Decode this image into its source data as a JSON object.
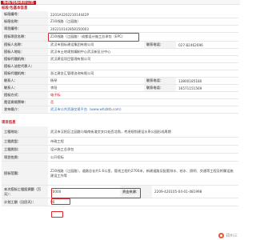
{
  "header": {
    "title": "标段/招标项目公告"
  },
  "section1": {
    "title": "标段/包基本信息"
  },
  "rows": {
    "code": {
      "label": "标段编号：",
      "value": "2201A320221014442P"
    },
    "sect_name": {
      "label": "标段名称：",
      "value": "Z10线路（江园路）"
    },
    "project_code": {
      "label": "项目编号：",
      "value": "202210142858150003"
    },
    "project_name": {
      "label": "招标项目名称：",
      "value": "Z10线路（江园路）-成都设计施工总承包（EPC）"
    },
    "tender_org": {
      "label": "招标人名称：",
      "value": "武汉市国际建设集团有限公司"
    },
    "tender_contact_label": {
      "label": "联系电话：",
      "value": "027-82462696"
    },
    "address": {
      "label": "招标人地址：",
      "value": "武汉市土地规划编制中心武汉新区分中心"
    },
    "agent": {
      "label": "招标代理机构：",
      "value": "武汉建设项目管理有限公司"
    },
    "agent_rep": {
      "label": "招标人法定代表人：",
      "value": ""
    },
    "agent_org": {
      "label": "招标代理机构：",
      "value": "浙江建金汇管理咨询有限公司"
    },
    "contact": {
      "label": "联系人：",
      "value": "杨琴",
      "phone_label": "联系电话：",
      "phone": "13800185180"
    },
    "contact2": {
      "label": "联系人：",
      "value": "李阳",
      "phone_label": "联系电话：",
      "phone": "16571151569"
    },
    "method": {
      "label": "招标方式：",
      "value": "电子标"
    },
    "prequal": {
      "label": "是否资格预审：",
      "value": "否"
    },
    "site": {
      "label": "发布媒介：",
      "value": "武汉市公共资源交易平台（www.whzbtb.com）"
    }
  },
  "section2": {
    "title": "项目信息"
  },
  "rows2": {
    "location": {
      "label": "工程地址：",
      "value": "武汉市汉阳区江园路与城南街道交叉口处西北角，考虑规划建设水系公园形成周期"
    },
    "type": {
      "label": "工程类型：",
      "value": "市政工程"
    },
    "category": {
      "label": "工程类别：",
      "value": "设计施工总承包"
    },
    "nature": {
      "label": "项目性质：",
      "value": "公开招标"
    },
    "scale": {
      "label": "招标范围：",
      "value": "Z10线路（江园路），道路总长约1.6公里，管线工程约2700米，新建道路及配套排水、给水、照明、交通等工程及附属设施建设工作等"
    },
    "budget": {
      "label": "本次招标工程投资额（万元）：",
      "value": "70000",
      "amount_label": "资金来源：",
      "amount_value": "2209-420105-04-01-481998"
    },
    "period": {
      "label": "计划工期（日历天）：",
      "value": "90"
    }
  },
  "watermark": {
    "text": "郑州三"
  }
}
